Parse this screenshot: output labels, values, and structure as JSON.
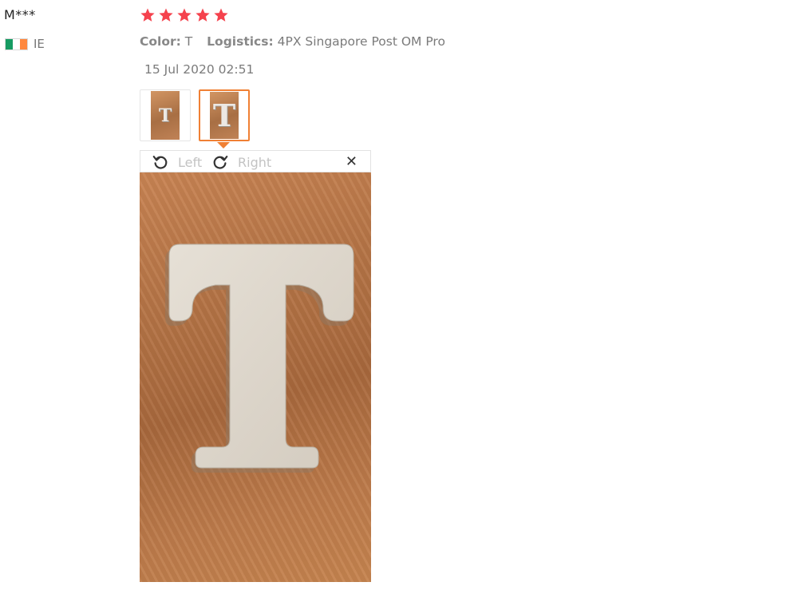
{
  "review": {
    "user_name": "M***",
    "country_code": "IE",
    "flag_colors": [
      "#169b62",
      "#ffffff",
      "#ff883e"
    ],
    "rating": 5,
    "rating_color": "#f5424d",
    "color_label": "Color:",
    "color_value": "T",
    "logistics_label": "Logistics:",
    "logistics_value": "4PX Singapore Post OM Pro",
    "date": "15 Jul 2020 02:51"
  },
  "thumbnails": [
    {
      "letter": "T",
      "selected": false
    },
    {
      "letter": "T",
      "selected": true
    }
  ],
  "viewer": {
    "rotate_left_label": "Left",
    "rotate_right_label": "Right",
    "close_glyph": "✕",
    "image_letter": "T"
  },
  "accent_color": "#f08034"
}
